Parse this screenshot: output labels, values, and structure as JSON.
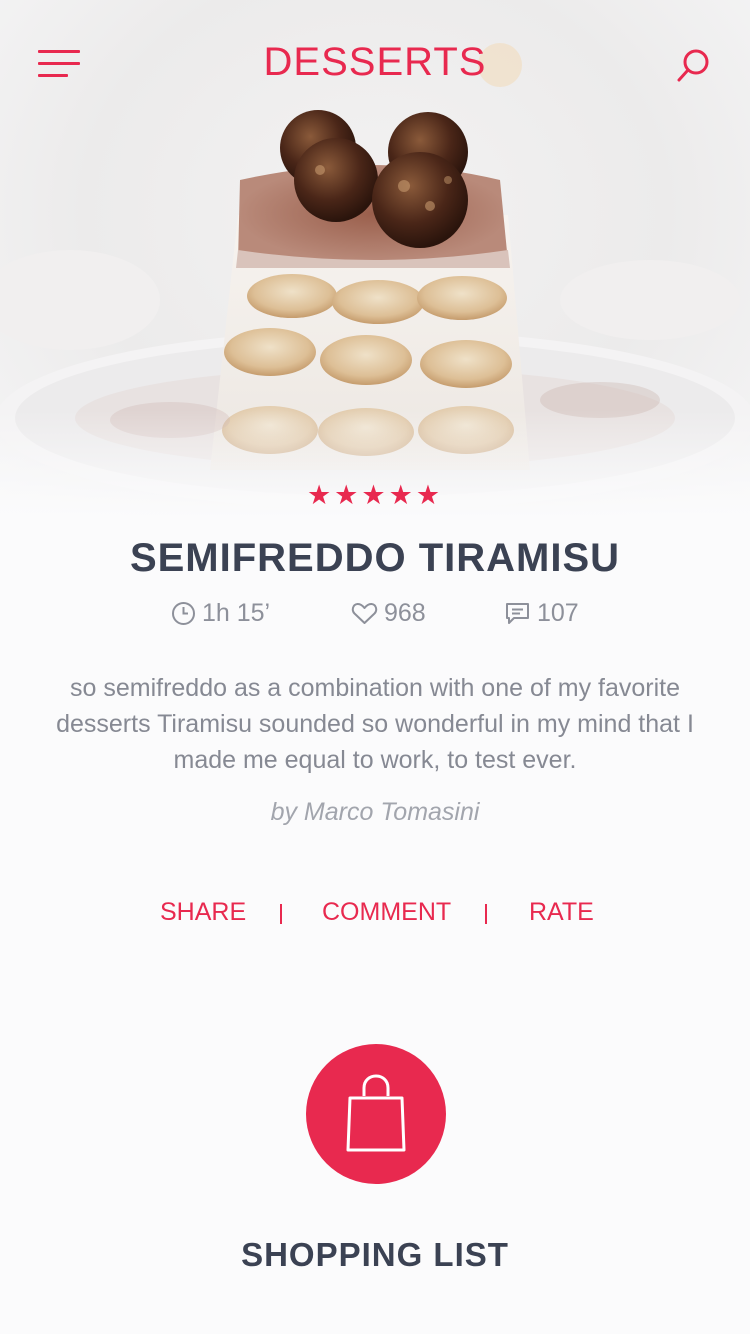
{
  "header": {
    "title": "DESSERTS",
    "menu_icon": "hamburger-icon",
    "search_icon": "search-icon"
  },
  "recipe": {
    "image": "semifreddo-tiramisu-photo",
    "rating": 5,
    "rating_max": 5,
    "title": "SEMIFREDDO TIRAMISU",
    "time": "1h 15’",
    "likes": "968",
    "comments": "107",
    "description": "so semifreddo as a combination with one of my favorite desserts Tiramisu sounded so wonderful in my mind that I made me equal to work, to test ever.",
    "author": "by Marco Tomasini"
  },
  "actions": {
    "share": "SHARE",
    "comment": "COMMENT",
    "rate": "RATE"
  },
  "shopping": {
    "icon": "shopping-bag-icon",
    "label": "SHOPPING LIST"
  },
  "colors": {
    "accent": "#e8294f",
    "heading": "#3b4253",
    "body_text": "#868993",
    "background": "#fbfbfc"
  }
}
